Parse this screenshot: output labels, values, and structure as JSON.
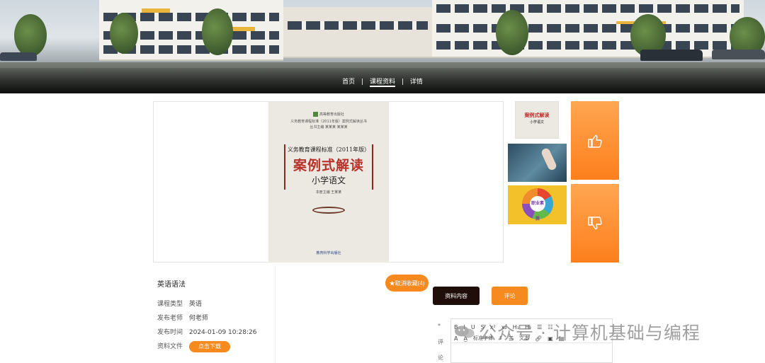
{
  "breadcrumb": {
    "home": "首页",
    "sep": "|",
    "courses": "课程资料",
    "detail": "详情"
  },
  "book": {
    "header1": "高等教育出版社",
    "header2": "义务教育课程标准（2011年版）案例式解读丛书",
    "editors": "丛书主编  某某某  某某某",
    "subtitle": "义务教育课程标准（2011年版）",
    "title": "案例式解读",
    "subject": "小学语文",
    "author": "本册主编  王某某",
    "publisher": "教育科学出版社"
  },
  "thumbs": {
    "t1_title": "案例式解读",
    "t1_subject": "小学语文",
    "t3_label": "职业素质"
  },
  "vote": {
    "like_icon": "thumbs-up-icon",
    "dislike_icon": "thumbs-down-icon"
  },
  "info": {
    "title": "英语语法",
    "type_label": "课程类型",
    "type_value": "英语",
    "teacher_label": "发布老师",
    "teacher_value": "何老师",
    "time_label": "发布时间",
    "time_value": "2024-01-09 10:28:26",
    "file_label": "资料文件",
    "download_label": "点击下载"
  },
  "actions": {
    "favorite_label": "★取消收藏(4)",
    "tab_content_label": "资料内容",
    "tab_comment_label": "评论"
  },
  "comment": {
    "label_char1": "评",
    "label_char2": "论",
    "marker": "*"
  },
  "editor": {
    "row1": [
      "B",
      "I",
      "U",
      "S",
      "x²",
      "x₂",
      "H₁",
      "H₂",
      "☰",
      "☷"
    ],
    "row2_a": "A",
    "row2_b": "A̲",
    "font_select": "标准字体",
    "text_select": "文本"
  },
  "watermark": {
    "text": "公众号 · 计算机基础与编程"
  },
  "colors": {
    "accent": "#f68a1f",
    "dark": "#1f0e09"
  }
}
